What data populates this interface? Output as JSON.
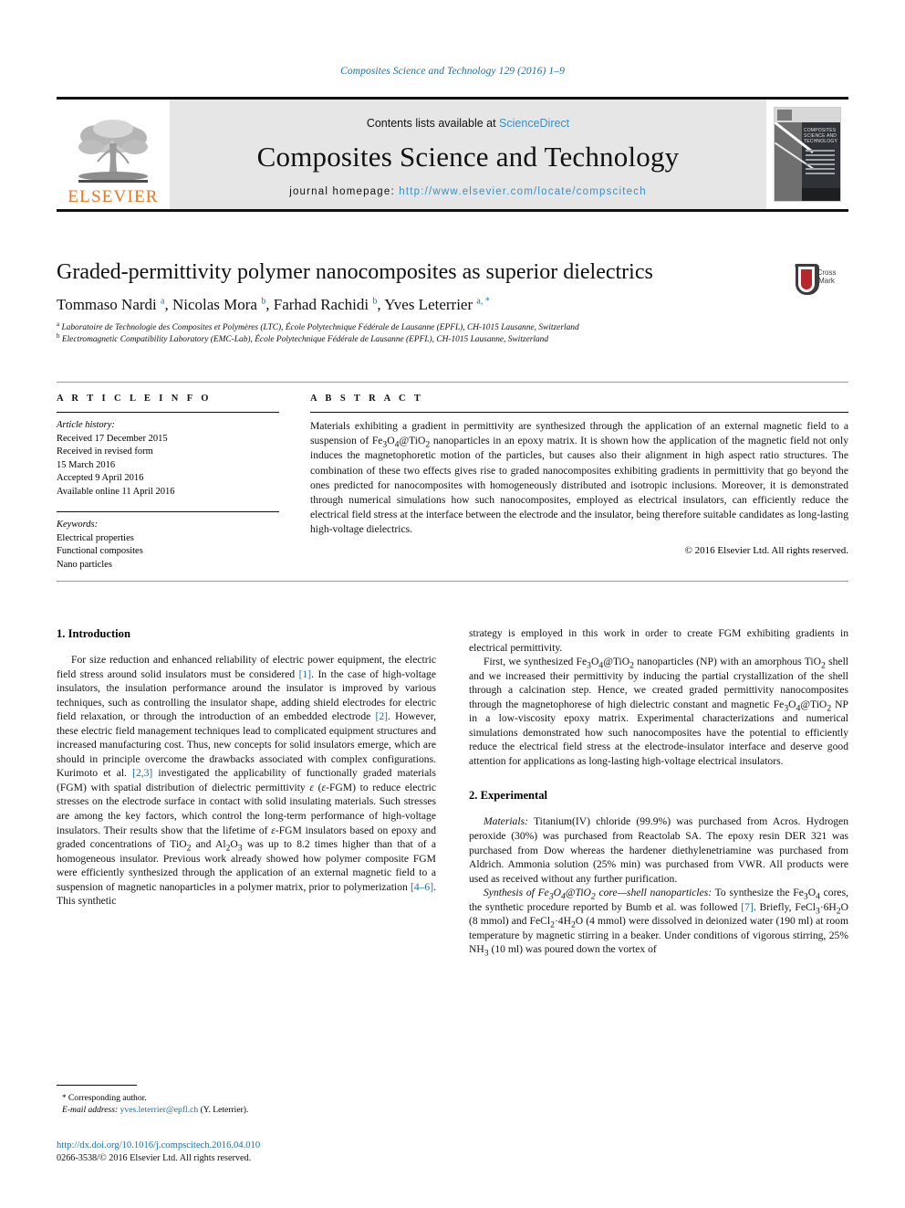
{
  "running_head": "Composites Science and Technology 129 (2016) 1–9",
  "masthead": {
    "publisher_name": "ELSEVIER",
    "contents_prefix": "Contents lists available at ",
    "contents_link": "ScienceDirect",
    "journal_title": "Composites Science and Technology",
    "homepage_label": "journal homepage: ",
    "homepage_url": "http://www.elsevier.com/locate/compscitech",
    "cover_title": "COMPOSITES SCIENCE AND TECHNOLOGY"
  },
  "article": {
    "title": "Graded-permittivity polymer nanocomposites as superior dielectrics",
    "crossmark_label": "CrossMark",
    "authors_html": "Tommaso Nardi <sup>a</sup>, Nicolas Mora <sup>b</sup>, Farhad Rachidi <sup>b</sup>, Yves Leterrier <sup>a, *</sup>",
    "affiliation_a": "Laboratoire de Technologie des Composites et Polymères (LTC), École Polytechnique Fédérale de Lausanne (EPFL), CH-1015 Lausanne, Switzerland",
    "affiliation_b": "Electromagnetic Compatibility Laboratory (EMC-Lab), École Polytechnique Fédérale de Lausanne (EPFL), CH-1015 Lausanne, Switzerland"
  },
  "article_info": {
    "heading": "A R T I C L E  I N F O",
    "history_title": "Article history:",
    "history": [
      "Received 17 December 2015",
      "Received in revised form",
      "15 March 2016",
      "Accepted 9 April 2016",
      "Available online 11 April 2016"
    ],
    "keywords_title": "Keywords:",
    "keywords": [
      "Electrical properties",
      "Functional composites",
      "Nano particles"
    ]
  },
  "abstract": {
    "heading": "A B S T R A C T",
    "text_html": "Materials exhibiting a gradient in permittivity are synthesized through the application of an external magnetic field to a suspension of Fe<sub>3</sub>O<sub>4</sub>@TiO<sub>2</sub> nanoparticles in an epoxy matrix. It is shown how the application of the magnetic field not only induces the magnetophoretic motion of the particles, but causes also their alignment in high aspect ratio structures. The combination of these two effects gives rise to graded nanocomposites exhibiting gradients in permittivity that go beyond the ones predicted for nanocomposites with homogeneously distributed and isotropic inclusions. Moreover, it is demonstrated through numerical simulations how such nanocomposites, employed as electrical insulators, can efficiently reduce the electrical field stress at the interface between the electrode and the insulator, being therefore suitable candidates as long-lasting high-voltage dielectrics.",
    "copyright": "© 2016 Elsevier Ltd. All rights reserved."
  },
  "body": {
    "section1_heading": "1. Introduction",
    "section1_p1_html": "For size reduction and enhanced reliability of electric power equipment, the electric field stress around solid insulators must be considered <span class=\"ref\">[1]</span>. In the case of high-voltage insulators, the insulation performance around the insulator is improved by various techniques, such as controlling the insulator shape, adding shield electrodes for electric field relaxation, or through the introduction of an embedded electrode <span class=\"ref\">[2]</span>. However, these electric field management techniques lead to complicated equipment structures and increased manufacturing cost. Thus, new concepts for solid insulators emerge, which are should in principle overcome the drawbacks associated with complex configurations. Kurimoto et al. <span class=\"ref\">[2,3]</span> investigated the applicability of functionally graded materials (FGM) with spatial distribution of dielectric permittivity <span class=\"ital\">ε</span> (<span class=\"ital\">ε</span>-FGM) to reduce electric stresses on the electrode surface in contact with solid insulating materials. Such stresses are among the key factors, which control the long-term performance of high-voltage insulators. Their results show that the lifetime of <span class=\"ital\">ε</span>-FGM insulators based on epoxy and graded concentrations of TiO<sub>2</sub> and Al<sub>2</sub>O<sub>3</sub> was up to 8.2 times higher than that of a homogeneous insulator. Previous work already showed how polymer composite FGM were efficiently synthesized through the application of an external magnetic field to a suspension of magnetic nanoparticles in a polymer matrix, prior to polymerization <span class=\"ref\">[4–6]</span>. This synthetic",
    "section1_p1_cont_html": "strategy is employed in this work in order to create FGM exhibiting gradients in electrical permittivity.",
    "section1_p2_html": "First, we synthesized Fe<sub>3</sub>O<sub>4</sub>@TiO<sub>2</sub> nanoparticles (NP) with an amorphous TiO<sub>2</sub> shell and we increased their permittivity by inducing the partial crystallization of the shell through a calcination step. Hence, we created graded permittivity nanocomposites through the magnetophorese of high dielectric constant and magnetic Fe<sub>3</sub>O<sub>4</sub>@TiO<sub>2</sub> NP in a low-viscosity epoxy matrix. Experimental characterizations and numerical simulations demonstrated how such nanocomposites have the potential to efficiently reduce the electrical field stress at the electrode-insulator interface and deserve good attention for applications as long-lasting high-voltage electrical insulators.",
    "section2_heading": "2. Experimental",
    "section2_p1_html": "<span class=\"ital\">Materials:</span> Titanium(IV) chloride (99.9%) was purchased from Acros. Hydrogen peroxide (30%) was purchased from Reactolab SA. The epoxy resin DER 321 was purchased from Dow whereas the hardener diethylenetriamine was purchased from Aldrich. Ammonia solution (25% min) was purchased from VWR. All products were used as received without any further purification.",
    "section2_p2_html": "<span class=\"ital\">Synthesis of Fe<sub>3</sub>O<sub>4</sub>@TiO<sub>2</sub> core—shell nanoparticles:</span> To synthesize the Fe<sub>3</sub>O<sub>4</sub> cores, the synthetic procedure reported by Bumb et al. was followed <span class=\"ref\">[7]</span>. Briefly, FeCl<sub>3</sub>·6H<sub>2</sub>O (8 mmol) and FeCl<sub>2</sub>·4H<sub>2</sub>O (4 mmol) were dissolved in deionized water (190 ml) at room temperature by magnetic stirring in a beaker. Under conditions of vigorous stirring, 25% NH<sub>3</sub> (10 ml) was poured down the vortex of"
  },
  "footer": {
    "corresponding_label": "Corresponding author.",
    "email_label": "E-mail address:",
    "email": "yves.leterrier@epfl.ch",
    "email_owner": "(Y. Leterrier).",
    "doi_url": "http://dx.doi.org/10.1016/j.compscitech.2016.04.010",
    "issn_line": "0266-3538/© 2016 Elsevier Ltd. All rights reserved."
  },
  "colors": {
    "link_blue": "#1d6fa5",
    "elsevier_orange": "#E87722",
    "crossmark_red": "#b3282d",
    "band_gray": "#e6e6e6"
  }
}
